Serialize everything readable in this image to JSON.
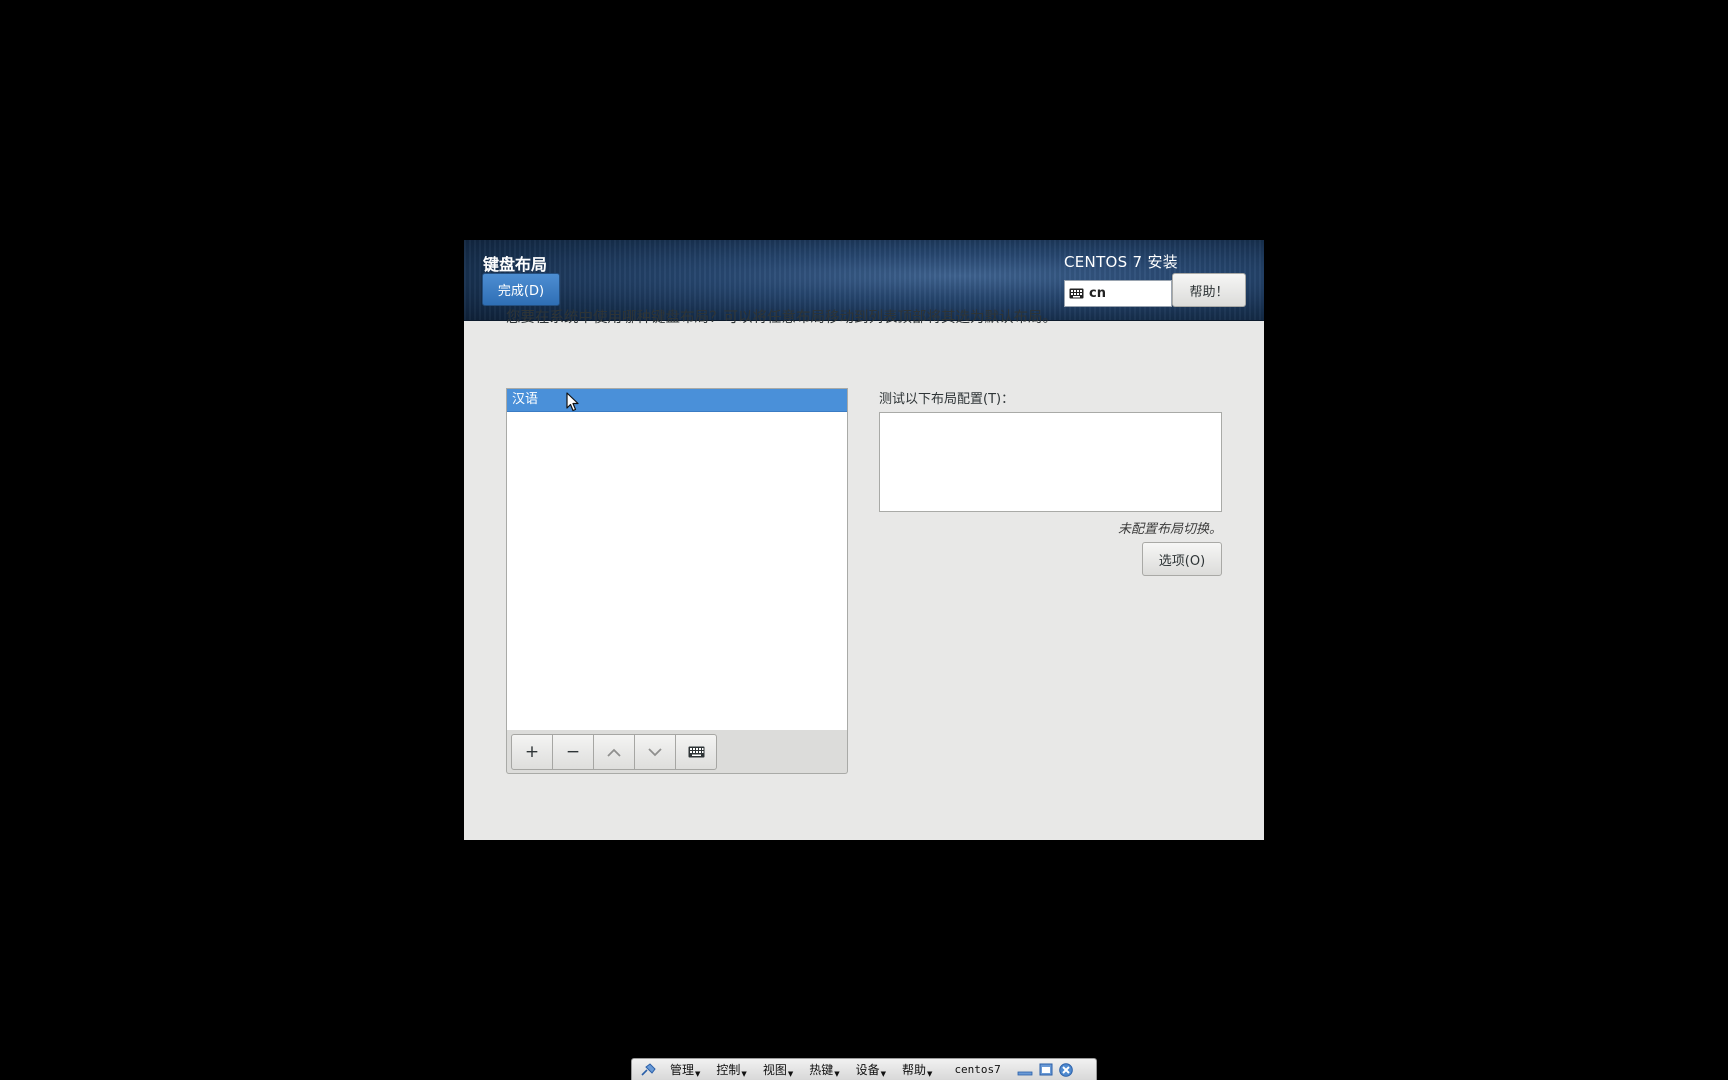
{
  "header": {
    "spoke_title": "键盘布局",
    "done_label": "完成(D)",
    "product_title": "CENTOS 7 安装",
    "keyboard_indicator": "cn",
    "help_label": "帮助！"
  },
  "main": {
    "instruction": "您要在系统中使用哪种键盘布局？可以将任意布局移动到列表顶部将其选为默认布局。",
    "layouts": [
      {
        "label": "汉语",
        "selected": true
      }
    ],
    "toolbar": {
      "add_label": "+",
      "remove_label": "−",
      "icons": [
        "plus-icon",
        "minus-icon",
        "chevron-up-icon",
        "chevron-down-icon",
        "keyboard-icon"
      ]
    },
    "test_label": "测试以下布局配置(T)：",
    "test_value": "",
    "no_switch_text": "未配置布局切换。",
    "options_label": "选项(O)"
  },
  "vm_bar": {
    "menus": [
      "管理",
      "控制",
      "视图",
      "热键",
      "设备",
      "帮助"
    ],
    "vm_name": "centos7"
  },
  "colors": {
    "selection": "#4a90d9",
    "done_button": "#3a7fc6",
    "background": "#e8e8e7",
    "header": "#1d3a5f"
  }
}
